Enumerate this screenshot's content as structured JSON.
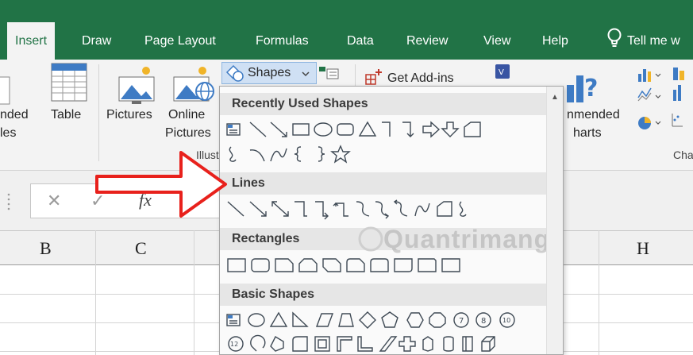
{
  "tabs": [
    {
      "label": "Insert",
      "active": true
    },
    {
      "label": "Draw"
    },
    {
      "label": "Page Layout"
    },
    {
      "label": "Formulas"
    },
    {
      "label": "Data"
    },
    {
      "label": "Review"
    },
    {
      "label": "View"
    },
    {
      "label": "Help"
    },
    {
      "label": "Tell me w"
    }
  ],
  "ribbon": {
    "recommended_pivot_line1": "nded",
    "recommended_pivot_line2": "les",
    "table": "Table",
    "pictures": "Pictures",
    "online_line1": "Online",
    "online_line2": "Pictures",
    "illustrations_group": "Illust",
    "shapes": "Shapes",
    "get_addins": "Get Add-ins",
    "rec_charts_line1": "nmended",
    "rec_charts_line2": "harts",
    "charts_group": "Cha"
  },
  "formula_bar": {
    "cancel": "✕",
    "enter": "✓",
    "fx": "fx"
  },
  "columns": [
    "B",
    "C",
    "H"
  ],
  "shapes_menu": {
    "sections": {
      "recent": "Recently Used Shapes",
      "lines": "Lines",
      "rectangles": "Rectangles",
      "basic": "Basic Shapes"
    },
    "basic_numbers": [
      "7",
      "8",
      "10",
      "12"
    ]
  },
  "watermark": "Quantrimang",
  "colors": {
    "ribbon_green": "#217346",
    "arrow_red": "#e8211c",
    "shape_stroke": "#3f4a55"
  }
}
